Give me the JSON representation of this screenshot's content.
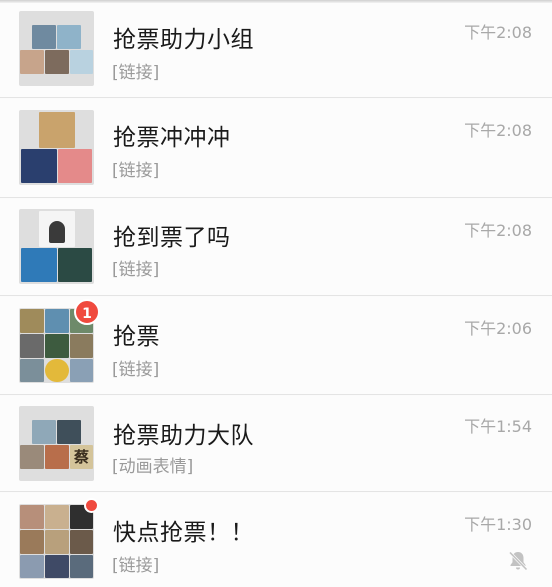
{
  "chats": [
    {
      "name": "抢票助力小组",
      "preview": "[链接]",
      "time": "下午2:08",
      "avatar_tiles": [
        "#6f8aa0",
        "#8fb3c9",
        "#c7a48b",
        "#7d6b5d",
        "#b9d2e0",
        "#d9c1a8"
      ]
    },
    {
      "name": "抢票冲冲冲",
      "preview": "[链接]",
      "time": "下午2:08",
      "avatar_tiles": [
        "#c9a36c",
        "#2a3f6e",
        "#e48a8a"
      ]
    },
    {
      "name": "抢到票了吗",
      "preview": "[链接]",
      "time": "下午2:08",
      "avatar_tiles": [
        "#3a3a3a",
        "#2f7ab8",
        "#2b4a44"
      ]
    },
    {
      "name": "抢票",
      "preview": "[链接]",
      "time": "下午2:06",
      "badge": "1",
      "avatar_tiles": [
        "#9f8b5b",
        "#5f8fb0",
        "#6e8a6a",
        "#6a6a6a",
        "#3d5b3f",
        "#8a7b5e",
        "#7b8f9a",
        "#e3b93a",
        "#8aa0b5"
      ]
    },
    {
      "name": "抢票助力大队",
      "preview": "[动画表情]",
      "time": "下午1:54",
      "avatar_tiles": [
        "#8fa8b8",
        "#3f4f5a",
        "#9a8a7a",
        "#b86e4b",
        "#d4c49a"
      ],
      "avatar_glyph": "蔡"
    },
    {
      "name": "快点抢票！！",
      "preview": "[链接]",
      "time": "下午1:30",
      "muted": true,
      "avatar_tiles": [
        "#b78f7a",
        "#c9b08f",
        "#2f2f2f",
        "#9a7a5a",
        "#b8a07c",
        "#6b5a4a",
        "#8b9bb0",
        "#3f4a66",
        "#5a6b7c"
      ],
      "mute_icon": "bell-off-icon"
    }
  ]
}
